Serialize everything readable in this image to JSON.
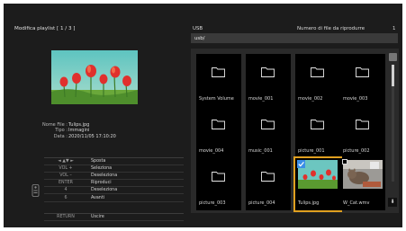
{
  "left": {
    "playlist_title": "Modifica playlist [ 1 / 3 ]",
    "details": [
      {
        "key": "Nome File :",
        "value": "Tulips.jpg"
      },
      {
        "key": "Tipo :",
        "value": "Immagini"
      },
      {
        "key": "Data :",
        "value": "2020/11/05 17:10:20"
      }
    ],
    "help": [
      {
        "key": "◄ ▲▼ ►",
        "value": "Sposta"
      },
      {
        "key": "VOL +",
        "value": "Seleziona"
      },
      {
        "key": "VOL –",
        "value": "Deseleziona"
      },
      {
        "key": "ENTER",
        "value": "Riproduci"
      },
      {
        "key": "4",
        "value": "Deseleziona"
      },
      {
        "key": "6",
        "value": "Avanti"
      },
      {
        "key": "RETURN",
        "value": "Uscire"
      }
    ]
  },
  "right": {
    "source_label": "USB",
    "count_label": "Numero di file da riprodurre",
    "count_value": "1",
    "path": "usb/",
    "tiles": [
      {
        "label": "System Volume",
        "kind": "folder"
      },
      {
        "label": "movie_001",
        "kind": "folder"
      },
      {
        "label": "movie_002",
        "kind": "folder"
      },
      {
        "label": "movie_003",
        "kind": "folder"
      },
      {
        "label": "movie_004",
        "kind": "folder"
      },
      {
        "label": "music_001",
        "kind": "folder"
      },
      {
        "label": "picture_001",
        "kind": "folder"
      },
      {
        "label": "picture_002",
        "kind": "folder"
      },
      {
        "label": "picture_003",
        "kind": "folder"
      },
      {
        "label": "picture_004",
        "kind": "folder"
      },
      {
        "label": "Tulips.jpg",
        "kind": "image",
        "checked": true,
        "selected": true
      },
      {
        "label": "W_Cat.wmv",
        "kind": "video",
        "checked": false
      }
    ]
  },
  "colors": {
    "background": "#1c1c1c",
    "tile": "#000000",
    "highlight": "#e0a020",
    "check": "#3a8ee6"
  }
}
